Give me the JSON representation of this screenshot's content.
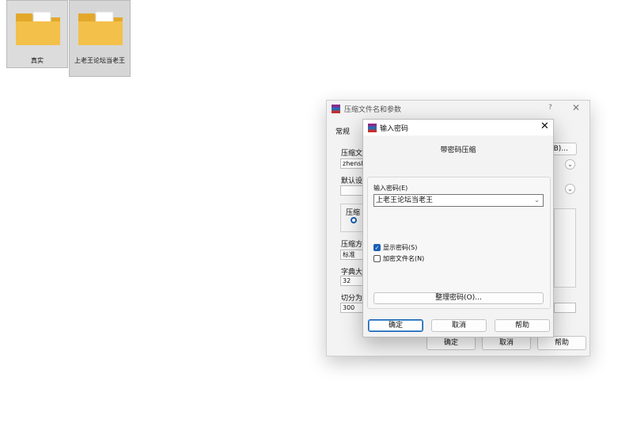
{
  "desktop": {
    "icons": [
      {
        "label": "真实"
      },
      {
        "label": "上老王论坛当老王"
      }
    ]
  },
  "back_dialog": {
    "title": "压缩文件名和参数",
    "help_glyph": "?",
    "close_glyph": "✕",
    "tab": "常规",
    "archive_label": "压缩文",
    "archive_value": "zhensh",
    "browse_btn": "(B)...",
    "default_label": "默认设",
    "group_label": "压缩",
    "method_label": "压缩方",
    "method_value": "标准",
    "dict_label": "字典大",
    "dict_value": "32",
    "split_label": "切分为",
    "split_value": "300",
    "ok_btn": "确定",
    "cancel_btn": "取消",
    "help_btn": "帮助"
  },
  "front_dialog": {
    "title": "输入密码",
    "close_glyph": "✕",
    "subtitle": "带密码压缩",
    "password_label": "输入密码(E)",
    "password_value": "上老王论坛当老王",
    "show_password_label": "显示密码(S)",
    "show_password_checked": true,
    "encrypt_names_label": "加密文件名(N)",
    "encrypt_names_checked": false,
    "organize_btn": "整理密码(O)...",
    "ok_btn": "确定",
    "cancel_btn": "取消",
    "help_btn": "帮助"
  },
  "colors": {
    "accent": "#1a5fb4",
    "folder": "#f3c04a",
    "folder_dark": "#e3a82b"
  }
}
